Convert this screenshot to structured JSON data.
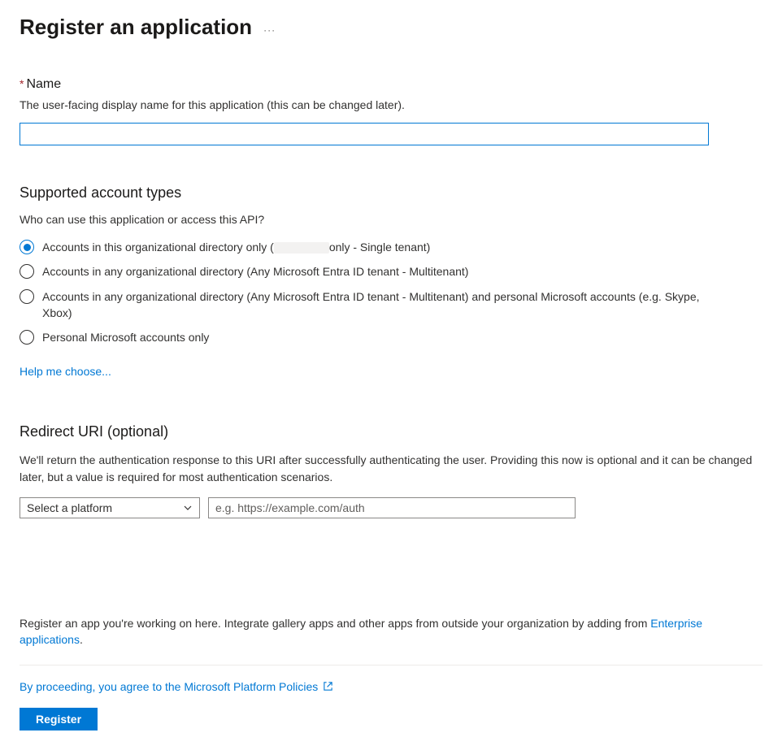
{
  "header": {
    "title": "Register an application"
  },
  "name_field": {
    "label": "Name",
    "required_mark": "*",
    "description": "The user-facing display name for this application (this can be changed later).",
    "value": ""
  },
  "account_types": {
    "heading": "Supported account types",
    "question": "Who can use this application or access this API?",
    "options": [
      {
        "label_prefix": "Accounts in this organizational directory only (",
        "label_suffix": "only - Single tenant)",
        "selected": true
      },
      {
        "label": "Accounts in any organizational directory (Any Microsoft Entra ID tenant - Multitenant)",
        "selected": false
      },
      {
        "label": "Accounts in any organizational directory (Any Microsoft Entra ID tenant - Multitenant) and personal Microsoft accounts (e.g. Skype, Xbox)",
        "selected": false
      },
      {
        "label": "Personal Microsoft accounts only",
        "selected": false
      }
    ],
    "help_link": "Help me choose..."
  },
  "redirect_uri": {
    "heading": "Redirect URI (optional)",
    "description": "We'll return the authentication response to this URI after successfully authenticating the user. Providing this now is optional and it can be changed later, but a value is required for most authentication scenarios.",
    "platform_placeholder": "Select a platform",
    "uri_placeholder": "e.g. https://example.com/auth"
  },
  "footer": {
    "text_prefix": "Register an app you're working on here. Integrate gallery apps and other apps from outside your organization by adding from ",
    "enterprise_link": "Enterprise applications",
    "text_suffix": ".",
    "policies_link": "By proceeding, you agree to the Microsoft Platform Policies",
    "register_button": "Register"
  }
}
